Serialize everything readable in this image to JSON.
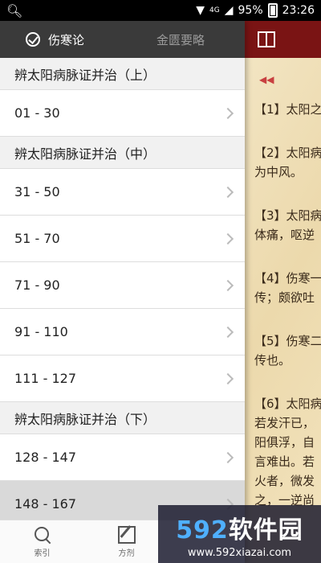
{
  "status_bar": {
    "battery": "95%",
    "time": "23:26",
    "network": "4G"
  },
  "tabs": [
    {
      "label": "伤寒论",
      "active": true
    },
    {
      "label": "金匮要略",
      "active": false
    }
  ],
  "sections": [
    {
      "title": "辨太阳病脉证并治（上）",
      "rows": [
        "01 - 30"
      ]
    },
    {
      "title": "辨太阳病脉证并治（中）",
      "rows": [
        "31 - 50",
        "51 - 70",
        "71 - 90",
        "91 - 110",
        "111 - 127"
      ]
    },
    {
      "title": "辨太阳病脉证并治（下）",
      "rows": [
        "128 - 147",
        "148 - 167"
      ]
    }
  ],
  "bottom_nav": [
    {
      "label": "索引",
      "icon": "search-icon"
    },
    {
      "label": "方剂",
      "icon": "edit-icon"
    }
  ],
  "reader": {
    "verses": [
      "【1】太阳之",
      "【2】太阳病\n为中风。",
      "【3】太阳病\n体痛，呕逆",
      "【4】伤寒一\n传；颇欲吐",
      "【5】伤寒二\n传也。",
      "【6】太阳病\n若发汗已，\n阳俱浮，自\n言难出。若\n火者，微发\n之，一逆尚"
    ]
  },
  "watermark": {
    "brand_number": "592",
    "brand_text": "软件园",
    "url": "www.592xiazai.com"
  },
  "colors": {
    "tab_bar": "#3a3a3a",
    "reader_header": "#7a1414",
    "parchment": "#f0e0b8"
  }
}
